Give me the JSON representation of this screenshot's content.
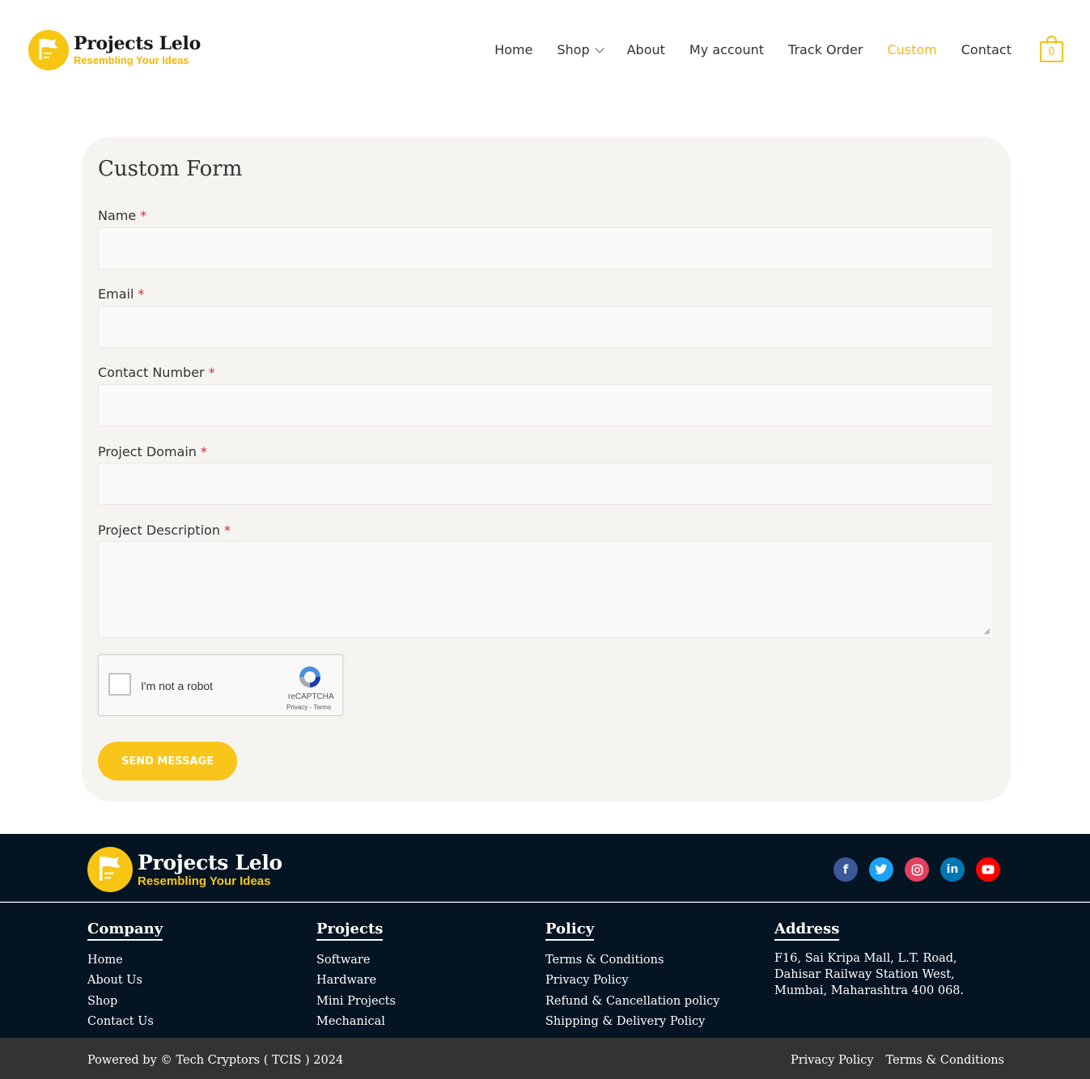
{
  "brand": {
    "name": "Projects Lelo",
    "tagline": "Resembling Your Ideas"
  },
  "nav": {
    "items": [
      {
        "label": "Home"
      },
      {
        "label": "Shop"
      },
      {
        "label": "About"
      },
      {
        "label": "My account"
      },
      {
        "label": "Track Order"
      },
      {
        "label": "Custom"
      },
      {
        "label": "Contact"
      }
    ],
    "cart_count": "0"
  },
  "form": {
    "title": "Custom Form",
    "fields": [
      {
        "label": "Name",
        "required": "*"
      },
      {
        "label": "Email",
        "required": "*"
      },
      {
        "label": "Contact Number",
        "required": "*"
      },
      {
        "label": "Project Domain",
        "required": "*"
      },
      {
        "label": "Project Description",
        "required": "*"
      }
    ],
    "captcha": {
      "label": "I'm not a robot",
      "brand": "reCAPTCHA",
      "links": "Privacy - Terms"
    },
    "submit_label": "SEND MESSAGE"
  },
  "footer": {
    "social_icons": [
      "facebook-icon",
      "twitter-icon",
      "instagram-icon",
      "linkedin-icon",
      "youtube-icon"
    ],
    "columns": {
      "company": {
        "heading": "Company",
        "links": [
          "Home",
          "About Us",
          "Shop",
          "Contact Us"
        ]
      },
      "projects": {
        "heading": "Projects",
        "links": [
          "Software",
          "Hardware",
          "Mini Projects",
          "Mechanical"
        ]
      },
      "policy": {
        "heading": "Policy",
        "links": [
          "Terms & Conditions",
          "Privacy Policy",
          "Refund & Cancellation policy",
          "Shipping & Delivery Policy"
        ]
      },
      "address": {
        "heading": "Address",
        "text": "F16, Sai Kripa Mall, L.T. Road, Dahisar Railway Station West, Mumbai, Maharashtra 400 068."
      }
    },
    "powered_by": "Powered by © Tech Cryptors ( TCIS ) 2024",
    "bottom_links": [
      "Privacy Policy",
      "Terms & Conditions"
    ]
  },
  "colors": {
    "accent": "#f9c51a",
    "footer_bg": "#051422",
    "bottom_bar": "#333333",
    "card_bg": "#f5f4f0",
    "required": "#e2252b"
  }
}
